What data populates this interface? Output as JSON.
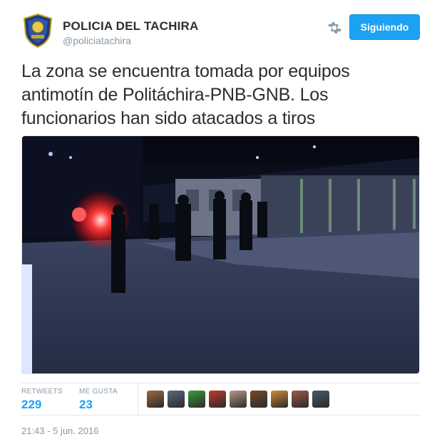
{
  "account": {
    "name": "POLICIA DEL TACHIRA",
    "handle": "@policiatachira",
    "follow_label": "Siguiendo"
  },
  "tweet": {
    "text": "La zona se encuentra tomada por equipos antimotín de Politáchira-PNB-GNB. Los funcionarios han sido atacados a tiros",
    "timestamp": "21:43 - 5 jun. 2016"
  },
  "stats": {
    "retweets_label": "RETWEETS",
    "retweets_value": "229",
    "likes_label": "ME GUSTA",
    "likes_value": "23"
  },
  "likers": [
    {
      "color": "#a0683f"
    },
    {
      "color": "#5a6b7c"
    },
    {
      "color": "#3a9c3a"
    },
    {
      "color": "#c0392b"
    },
    {
      "color": "#b89a86"
    },
    {
      "color": "#7a4a2a"
    },
    {
      "color": "#d08a3a"
    },
    {
      "color": "#9c5a4a"
    },
    {
      "color": "#4a5a6a"
    }
  ],
  "colors": {
    "accent": "#1da1f2",
    "muted": "#8899a6",
    "text": "#292f33"
  }
}
